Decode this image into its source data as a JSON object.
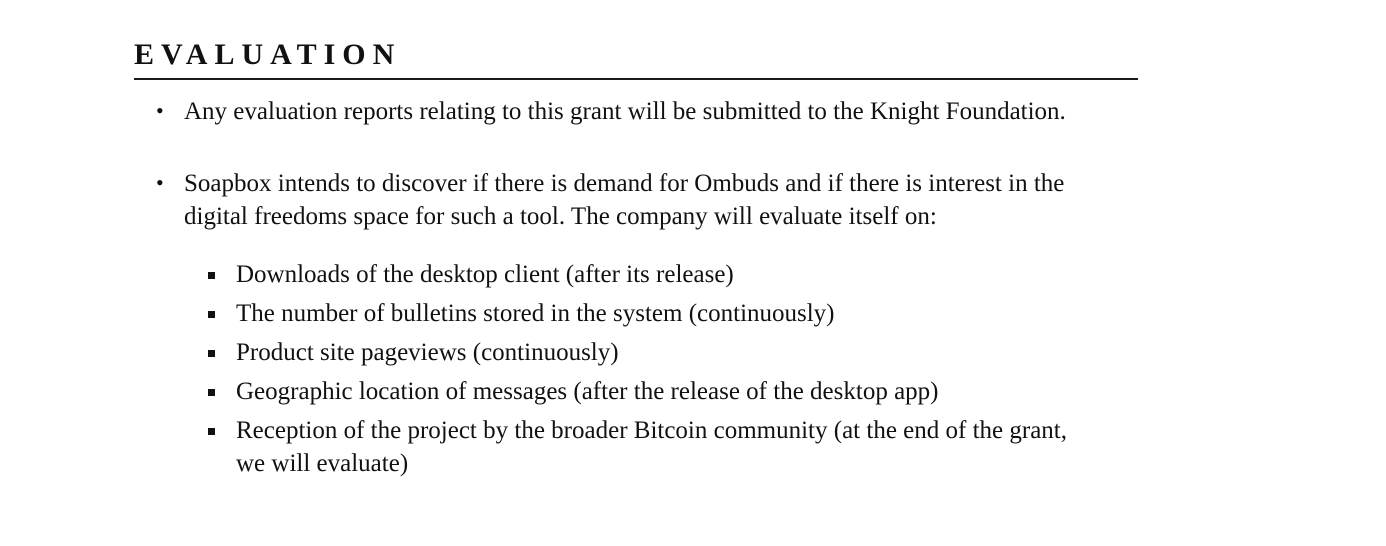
{
  "section": {
    "title": "EVALUATION"
  },
  "bullets": [
    {
      "text": "Any evaluation reports relating to this grant will be submitted to the Knight Foundation."
    },
    {
      "line1": "Soapbox intends to discover if there is demand for Ombuds and if there is interest in the",
      "line2": "digital freedoms space for such a tool. The company will evaluate itself on:"
    }
  ],
  "criteria": [
    {
      "text": "Downloads of the desktop client (after its release)"
    },
    {
      "text": "The number of bulletins stored in the system (continuously)"
    },
    {
      "text": "Product site pageviews (continuously)"
    },
    {
      "text": "Geographic location of messages (after the release of the desktop app)"
    },
    {
      "line1": "Reception of the project by the broader Bitcoin community (at the end of the grant,",
      "line2": "we will evaluate)"
    }
  ]
}
